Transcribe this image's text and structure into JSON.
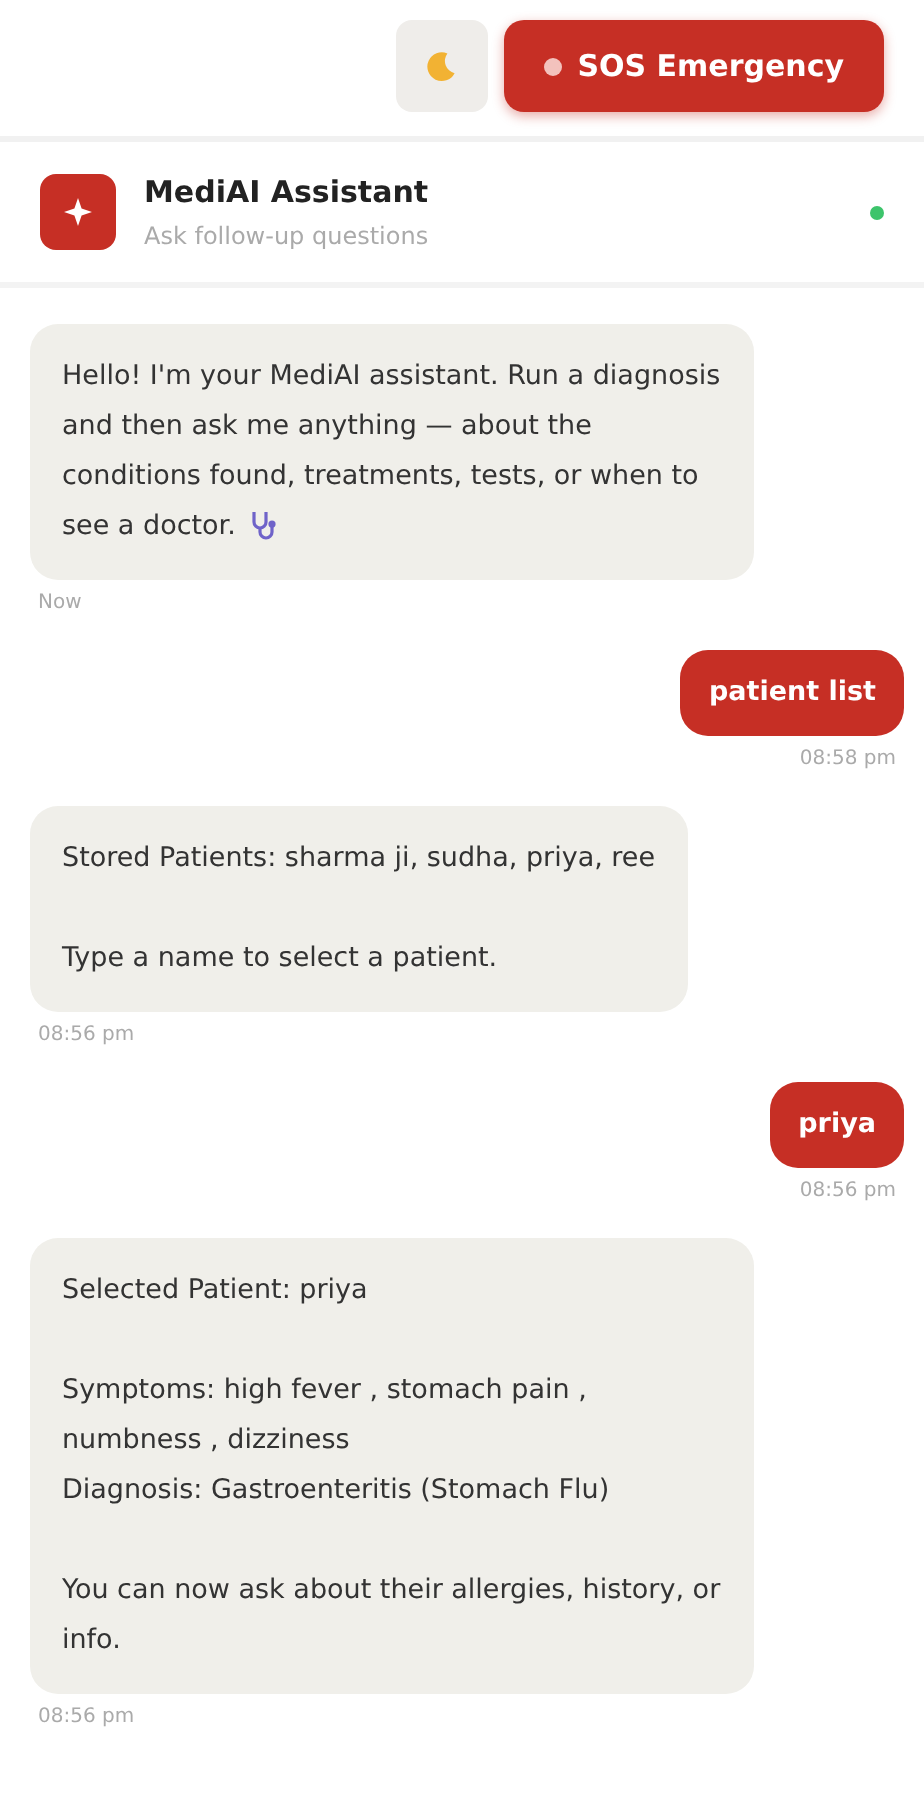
{
  "top_bar": {
    "sos_button": "SOS Emergency"
  },
  "header": {
    "title": "MediAI Assistant",
    "subtitle": "Ask follow-up questions",
    "online": true
  },
  "messages": [
    {
      "kind": "assistant",
      "text": "Hello! I'm your MediAI assistant. Run a diagnosis and then ask me anything — about the conditions found, treatments, tests, or when to see a doctor.",
      "has_icon": true,
      "time": "Now"
    },
    {
      "kind": "user",
      "text": "patient list",
      "time": "08:58 pm"
    },
    {
      "kind": "assistant",
      "text": "Stored Patients: sharma ji, sudha, priya, ree\n\nType a name to select a patient.",
      "time": "08:56 pm"
    },
    {
      "kind": "user",
      "text": "priya",
      "time": "08:56 pm"
    },
    {
      "kind": "assistant",
      "text": "Selected Patient: priya\n\nSymptoms: high fever , stomach pain , numbness , dizziness\nDiagnosis: Gastroenteritis (Stomach Flu)\n\nYou can now ask about their allergies, history, or info.",
      "time": "08:56 pm"
    }
  ]
}
